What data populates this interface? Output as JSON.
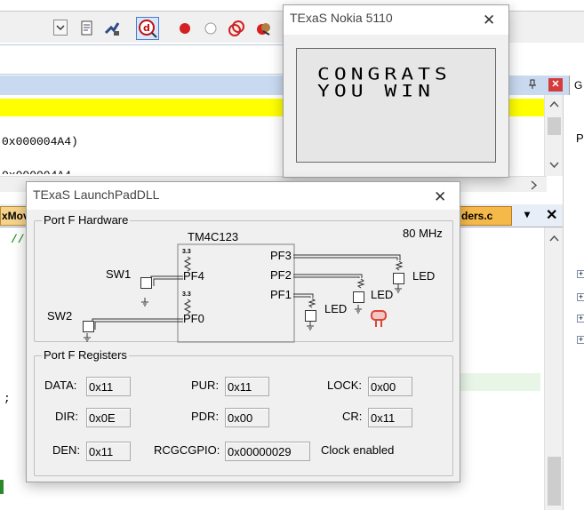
{
  "ide": {
    "code_line_1": "0x000004A4)",
    "code_line_2": "0x000004A4",
    "editor_tab_left": "xMov",
    "editor_tab_right": "ders.c",
    "comment_marker": "//",
    "semicolon": ";",
    "right_tab_letter": "G",
    "right_panel_letter": "P"
  },
  "nokia": {
    "title": "TExaS Nokia 5110",
    "lcd_line_1": "CONGRATS",
    "lcd_line_2": "YOU WIN"
  },
  "launchpad": {
    "title": "TExaS LaunchPadDLL",
    "hardware": {
      "legend": "Port F Hardware",
      "chip_name": "TM4C123",
      "clock_speed": "80 MHz",
      "pull_value": "3.3",
      "sw1": "SW1",
      "sw2": "SW2",
      "pf4": "PF4",
      "pf0": "PF0",
      "pf3": "PF3",
      "pf2": "PF2",
      "pf1": "PF1",
      "led": "LED"
    },
    "registers": {
      "legend": "Port F Registers",
      "data_label": "DATA:",
      "data_value": "0x11",
      "pur_label": "PUR:",
      "pur_value": "0x11",
      "lock_label": "LOCK:",
      "lock_value": "0x00",
      "dir_label": "DIR:",
      "dir_value": "0x0E",
      "pdr_label": "PDR:",
      "pdr_value": "0x00",
      "cr_label": "CR:",
      "cr_value": "0x11",
      "den_label": "DEN:",
      "den_value": "0x11",
      "rcgcgpio_label": "RCGCGPIO:",
      "rcgcgpio_value": "0x00000029",
      "clock_status": "Clock enabled"
    }
  },
  "colors": {
    "highlight_yellow": "#ffff00",
    "led_red": "#d9463a",
    "window_body": "#f0f0f0"
  }
}
